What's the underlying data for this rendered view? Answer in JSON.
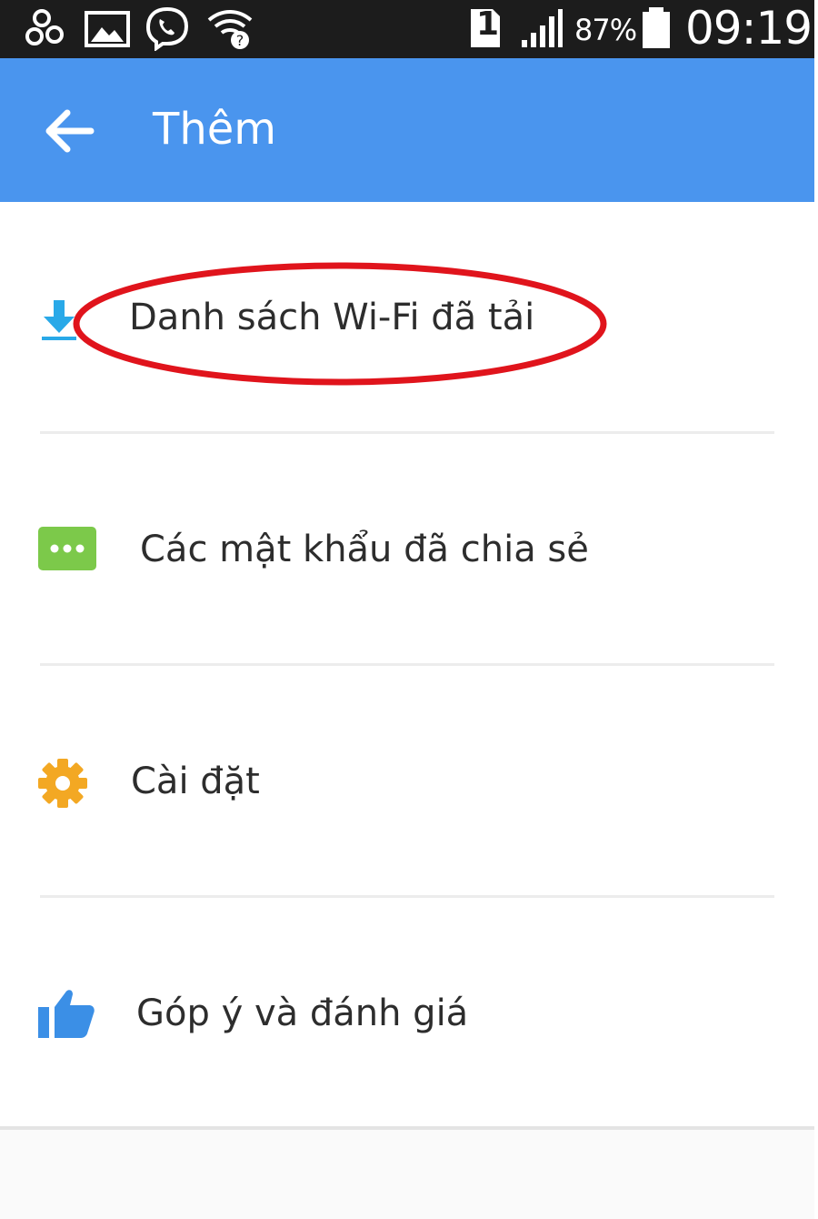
{
  "status_bar": {
    "icons": [
      "contacts-icon",
      "gallery-icon",
      "viber-icon",
      "wifi-question-icon",
      "sim-1-icon",
      "signal-icon",
      "battery-icon"
    ],
    "sim_label": "1",
    "battery_percent": "87%",
    "time": "09:19"
  },
  "app_bar": {
    "title": "Thêm",
    "back_icon": "arrow-back-icon",
    "background_color": "#4a95ee"
  },
  "menu": {
    "items": [
      {
        "label": "Danh sách Wi-Fi đã tải",
        "icon": "download-icon",
        "icon_color": "#29a9e8",
        "highlighted": true
      },
      {
        "label": "Các mật khẩu đã chia sẻ",
        "icon": "password-dots-icon",
        "icon_color": "#7cc94a"
      },
      {
        "label": "Cài đặt",
        "icon": "gear-icon",
        "icon_color": "#f3a823"
      },
      {
        "label": "Góp ý và đánh giá",
        "icon": "thumbs-up-icon",
        "icon_color": "#3b8fe6"
      }
    ]
  },
  "annotation": {
    "color": "#e0141c",
    "shape": "ellipse"
  }
}
